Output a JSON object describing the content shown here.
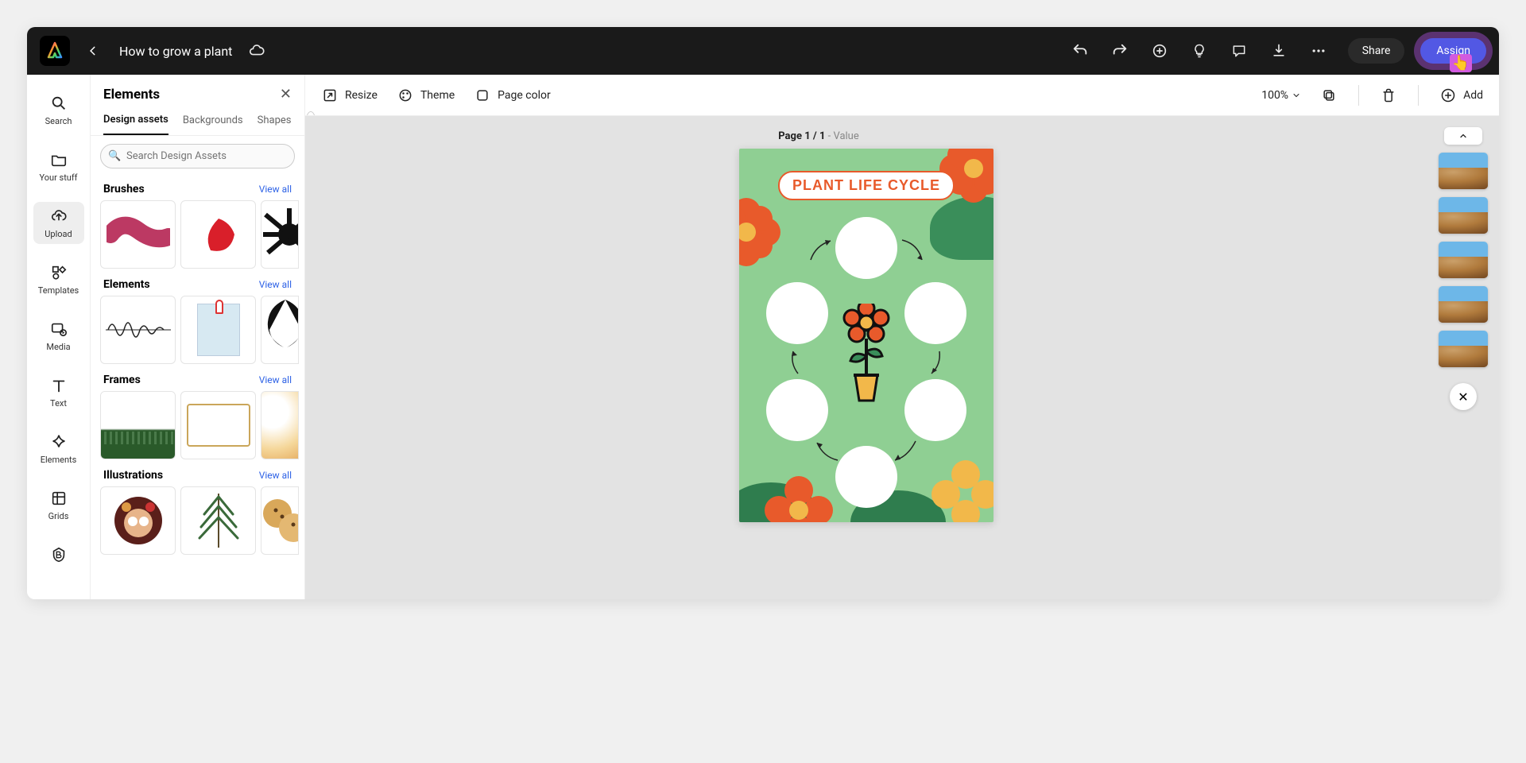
{
  "header": {
    "doc_title": "How to grow a plant",
    "share_label": "Share",
    "assign_label": "Assign"
  },
  "leftnav": {
    "items": [
      {
        "label": "Search"
      },
      {
        "label": "Your stuff"
      },
      {
        "label": "Upload"
      },
      {
        "label": "Templates"
      },
      {
        "label": "Media"
      },
      {
        "label": "Text"
      },
      {
        "label": "Elements"
      },
      {
        "label": "Grids"
      }
    ]
  },
  "panel": {
    "title": "Elements",
    "tabs": [
      "Design assets",
      "Backgrounds",
      "Shapes"
    ],
    "search_placeholder": "Search Design Assets",
    "sections": {
      "brushes": {
        "title": "Brushes",
        "viewall": "View all"
      },
      "elements": {
        "title": "Elements",
        "viewall": "View all"
      },
      "frames": {
        "title": "Frames",
        "viewall": "View all"
      },
      "illustrations": {
        "title": "Illustrations",
        "viewall": "View all"
      }
    }
  },
  "toolbar": {
    "resize": "Resize",
    "theme": "Theme",
    "pagecolor": "Page color",
    "zoom": "100%",
    "add": "Add"
  },
  "canvas": {
    "page_indicator_prefix": "Page ",
    "page_indicator": "1 / 1",
    "page_value_sep": " - ",
    "page_value": "Value",
    "artboard_title": "PLANT LIFE CYCLE"
  },
  "page_strip": {
    "count": 5
  }
}
